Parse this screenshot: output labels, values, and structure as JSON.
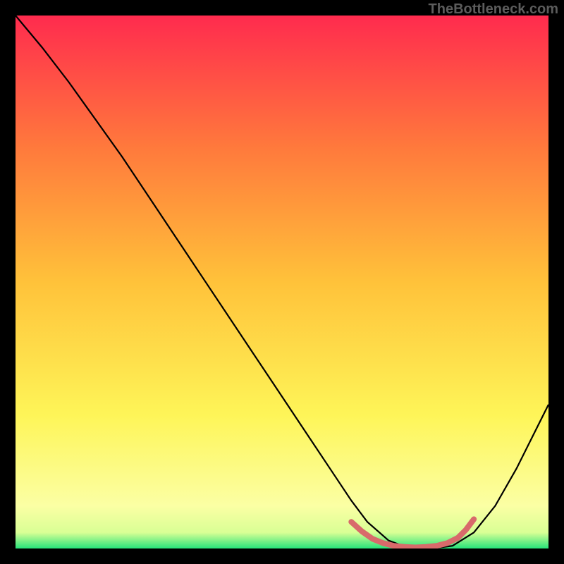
{
  "watermark": "TheBottleneck.com",
  "chart_data": {
    "type": "line",
    "title": "",
    "xlabel": "",
    "ylabel": "",
    "xlim": [
      0,
      100
    ],
    "ylim": [
      0,
      100
    ],
    "series": [
      {
        "name": "curve",
        "color": "#000000",
        "x": [
          0,
          5,
          10,
          15,
          20,
          25,
          30,
          35,
          40,
          45,
          50,
          55,
          60,
          63,
          66,
          70,
          74,
          78,
          82,
          86,
          90,
          94,
          100
        ],
        "y": [
          100,
          94,
          87.5,
          80.5,
          73.5,
          66,
          58.5,
          51,
          43.5,
          36,
          28.5,
          21,
          13.5,
          9,
          5,
          1.5,
          0,
          0,
          0.5,
          3,
          8,
          15,
          27
        ]
      },
      {
        "name": "optimal-marker",
        "color": "#d86a6b",
        "thickness": 8,
        "x": [
          63,
          65,
          67,
          69,
          71,
          73,
          75,
          77,
          79,
          81,
          83,
          84.5,
          86
        ],
        "y": [
          5,
          3.2,
          1.8,
          1,
          0.5,
          0.3,
          0.2,
          0.3,
          0.5,
          1,
          2,
          3.5,
          5.5
        ]
      }
    ],
    "gradient_stops": [
      {
        "offset": 0,
        "color": "#ff2b4e"
      },
      {
        "offset": 25,
        "color": "#ff7a3c"
      },
      {
        "offset": 50,
        "color": "#ffc23a"
      },
      {
        "offset": 75,
        "color": "#fef558"
      },
      {
        "offset": 92,
        "color": "#fbffa4"
      },
      {
        "offset": 97,
        "color": "#d9ff95"
      },
      {
        "offset": 100,
        "color": "#26e47a"
      }
    ]
  }
}
